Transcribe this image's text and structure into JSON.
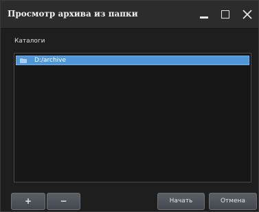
{
  "window": {
    "title": "Просмотр архива из папки"
  },
  "catalogs": {
    "label": "Каталоги",
    "items": [
      {
        "label": "D:/archive",
        "selected": true,
        "icon": "folder-icon"
      }
    ]
  },
  "buttons": {
    "add_label": "+",
    "remove_label": "−",
    "start_label": "Начать",
    "cancel_label": "Отмена"
  },
  "colors": {
    "selection": "#4f97d8",
    "background": "#1e1e1e",
    "button": "#50555c"
  }
}
